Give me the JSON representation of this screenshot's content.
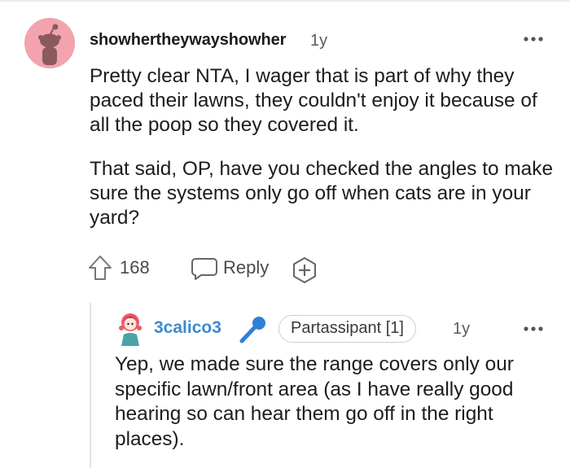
{
  "comment": {
    "username": "showhertheywayshowher",
    "age": "1y",
    "avatar": "reddit-snoo-avatar-icon",
    "paragraphs": [
      "Pretty clear NTA, I wager that is part of why they paced their lawns, they couldn't enjoy it because of all the poop so they covered it.",
      "That said, OP, have you checked the angles to make sure the systems only go off when cats are in your yard?"
    ],
    "votes": "168",
    "reply_label": "Reply",
    "more_icon": "more-options-icon",
    "award_icon": "award-plus-icon",
    "upvote_icon": "upvote-arrow-icon",
    "reply_icon": "reply-bubble-icon"
  },
  "reply": {
    "username": "3calico3",
    "flair": "Partassipant [1]",
    "age": "1y",
    "badge_icon": "microphone-icon",
    "avatar": "user-avatar-icon",
    "text": "Yep, we made sure the range covers only our specific lawn/front area (as I have really good hearing so can hear them go off in the right places).",
    "more_icon": "more-options-icon"
  },
  "colors": {
    "username_link": "#3d8ad2",
    "avatar_bg": "#f3a3ad",
    "thread_line": "#e4e4e4"
  }
}
